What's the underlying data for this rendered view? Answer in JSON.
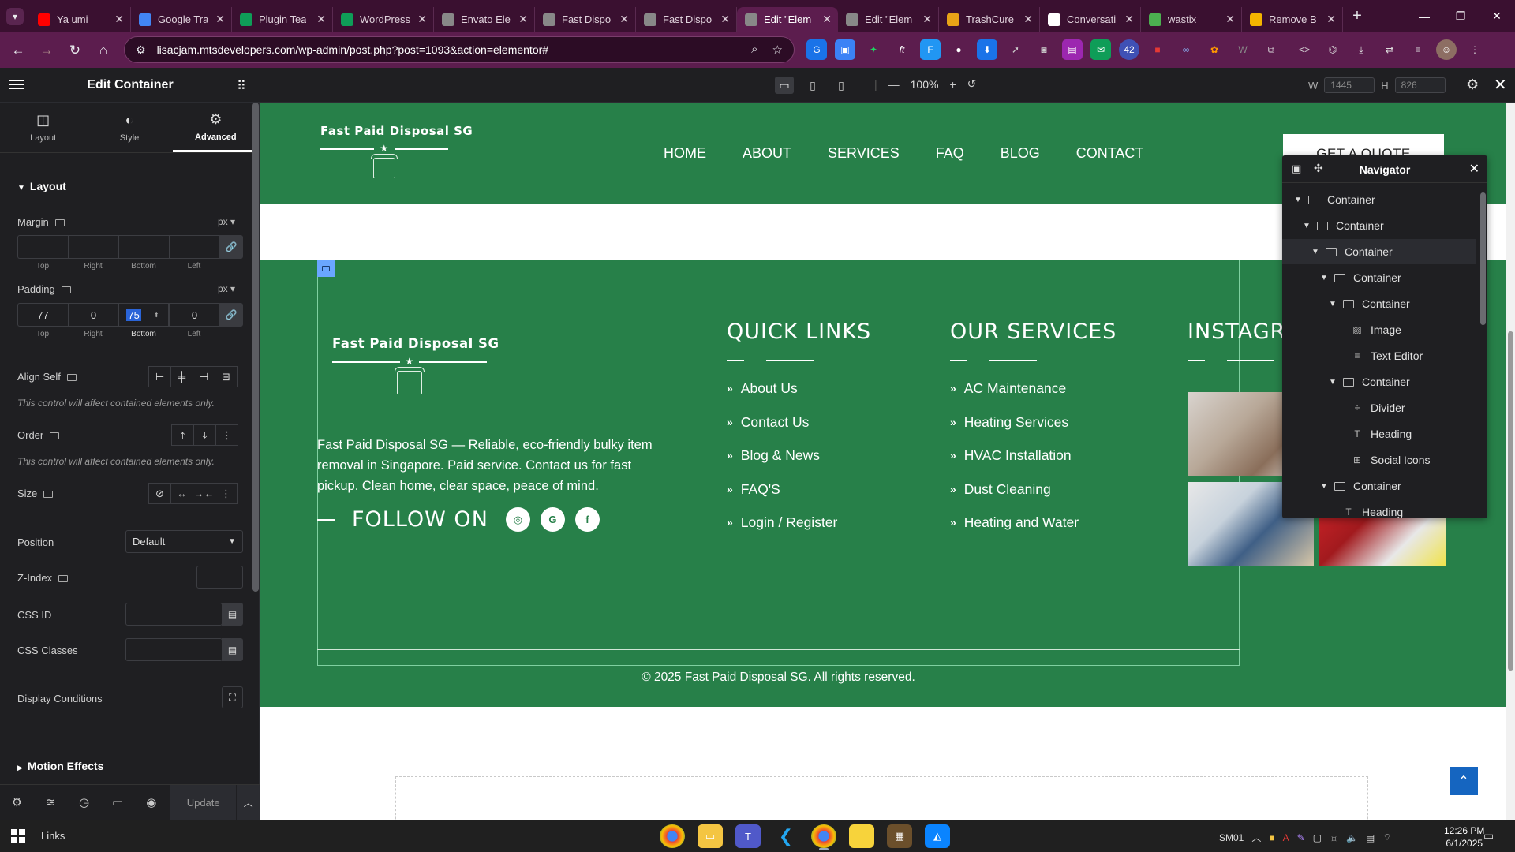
{
  "browser": {
    "tabs": [
      {
        "title": "Ya umi",
        "color": "#ff0000"
      },
      {
        "title": "Google Tra",
        "color": "#4285f4"
      },
      {
        "title": "Plugin Tea",
        "color": "#0f9d58"
      },
      {
        "title": "WordPress",
        "color": "#0f9d58"
      },
      {
        "title": "Envato Ele",
        "color": "#888888"
      },
      {
        "title": "Fast Dispo",
        "color": "#888888"
      },
      {
        "title": "Fast Dispo",
        "color": "#888888"
      },
      {
        "title": "Edit \"Elem",
        "color": "#888888",
        "active": true
      },
      {
        "title": "Edit \"Elem",
        "color": "#888888"
      },
      {
        "title": "TrashCure",
        "color": "#e8a317"
      },
      {
        "title": "Conversati",
        "color": "#ffffff"
      },
      {
        "title": "wastix",
        "color": "#4caf50"
      },
      {
        "title": "Remove B",
        "color": "#f4b400"
      }
    ],
    "url": "lisacjam.mtsdevelopers.com/wp-admin/post.php?post=1093&action=elementor#"
  },
  "editor": {
    "title": "Edit Container",
    "panel_tabs": [
      {
        "label": "Layout",
        "icon": "layout-icon"
      },
      {
        "label": "Style",
        "icon": "style-icon"
      },
      {
        "label": "Advanced",
        "icon": "gear-icon"
      }
    ],
    "zoom": "100%",
    "width_label": "W",
    "width_value": "1445",
    "height_label": "H",
    "height_value": "826"
  },
  "layout_section": {
    "heading": "Layout",
    "margin": {
      "label": "Margin",
      "unit": "px",
      "top": "",
      "right": "",
      "bottom": "",
      "left": ""
    },
    "padding": {
      "label": "Padding",
      "unit": "px",
      "top": "77",
      "right": "0",
      "bottom": "75",
      "left": "0"
    },
    "side_labels": {
      "top": "Top",
      "right": "Right",
      "bottom": "Bottom",
      "left": "Left"
    },
    "align_self_label": "Align Self",
    "align_note": "This control will affect contained elements only.",
    "order_label": "Order",
    "order_note": "This control will affect contained elements only.",
    "size_label": "Size",
    "position_label": "Position",
    "position_value": "Default",
    "zindex_label": "Z-Index",
    "cssid_label": "CSS ID",
    "cssclasses_label": "CSS Classes",
    "display_conditions_label": "Display Conditions",
    "motion_effects_label": "Motion Effects"
  },
  "footer_bar": {
    "update_label": "Update"
  },
  "site": {
    "logo_text": "Fast Paid Disposal SG",
    "menu": [
      "HOME",
      "ABOUT",
      "SERVICES",
      "FAQ",
      "BLOG",
      "CONTACT"
    ],
    "quote_button": "GET A QUOTE",
    "about_text": "Fast Paid Disposal SG — Reliable, eco-friendly bulky item removal in Singapore. Paid service. Contact us for fast pickup. Clean home, clear space, peace of mind.",
    "follow_label": "FOLLOW ON",
    "social": [
      "instagram-icon",
      "google-icon",
      "facebook-icon"
    ],
    "quick_links": {
      "heading": "QUICK LINKS",
      "items": [
        "About Us",
        "Contact Us",
        "Blog & News",
        "FAQ'S",
        "Login / Register"
      ]
    },
    "services": {
      "heading": "OUR SERVICES",
      "items": [
        "AC Maintenance",
        "Heating Services",
        "HVAC Installation",
        "Dust Cleaning",
        "Heating and Water"
      ]
    },
    "instagram_heading": "INSTAGR",
    "copyright": "© 2025 Fast Paid Disposal SG. All rights reserved."
  },
  "navigator": {
    "title": "Navigator",
    "items": [
      {
        "label": "Container",
        "icon": "container-icon"
      },
      {
        "label": "Container",
        "icon": "container-icon"
      },
      {
        "label": "Container",
        "icon": "container-icon"
      },
      {
        "label": "Container",
        "icon": "container-icon"
      },
      {
        "label": "Container",
        "icon": "container-icon"
      },
      {
        "label": "Image",
        "icon": "image-icon"
      },
      {
        "label": "Text Editor",
        "icon": "text-editor-icon"
      },
      {
        "label": "Container",
        "icon": "container-icon"
      },
      {
        "label": "Divider",
        "icon": "divider-icon"
      },
      {
        "label": "Heading",
        "icon": "heading-icon"
      },
      {
        "label": "Social Icons",
        "icon": "social-icons-icon"
      },
      {
        "label": "Container",
        "icon": "container-icon"
      },
      {
        "label": "Heading",
        "icon": "heading-icon"
      }
    ]
  },
  "taskbar": {
    "links_label": "Links",
    "tray_label": "SM01",
    "time": "12:26 PM",
    "date": "6/1/2025"
  }
}
